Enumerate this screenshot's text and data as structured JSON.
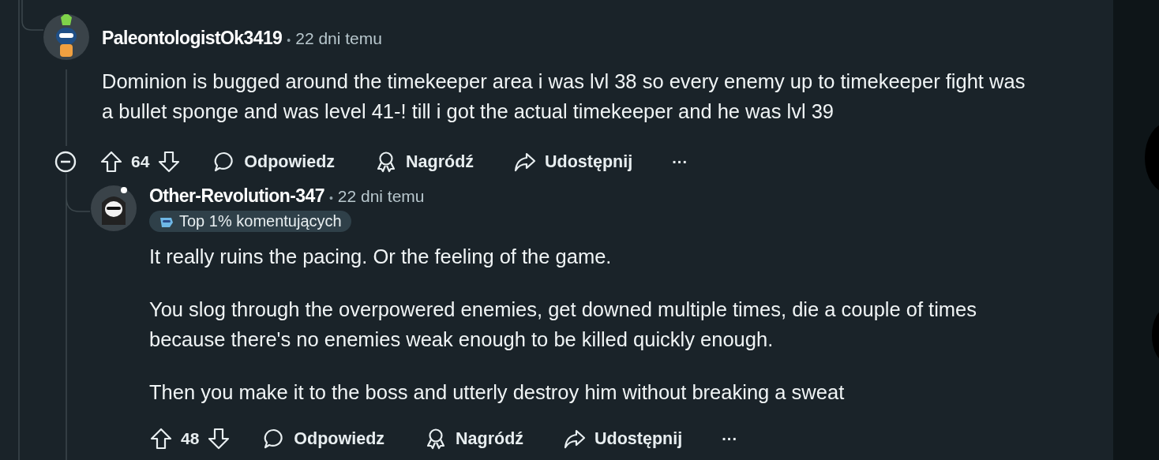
{
  "comments": [
    {
      "author": "PaleontologistOk3419",
      "time": "22 dni temu",
      "paragraphs": [
        "Dominion is bugged around the timekeeper area i was lvl 38 so every enemy up to timekeeper fight was\na bullet sponge and was level 41-! till i got the actual timekeeper and he was lvl 39"
      ],
      "score": "64",
      "actions": [
        "Odpowiedz",
        "Nagródź",
        "Udostępnij"
      ],
      "more": "···",
      "separator": "•",
      "replies": [
        {
          "author": "Other-Revolution-347",
          "time": "22 dni temu",
          "badge": "Top 1% komentujących",
          "paragraphs": [
            "It really ruins the pacing. Or the feeling of the game.",
            "You slog through the overpowered enemies, get downed multiple times, die a couple of times\nbecause there's no enemies weak enough to be killed quickly enough.",
            "Then you make it to the boss and utterly destroy him without breaking a sweat"
          ],
          "score": "48",
          "actions": [
            "Odpowiedz",
            "Nagródź",
            "Udostępnij"
          ],
          "more": "···",
          "separator": "•"
        }
      ]
    }
  ]
}
